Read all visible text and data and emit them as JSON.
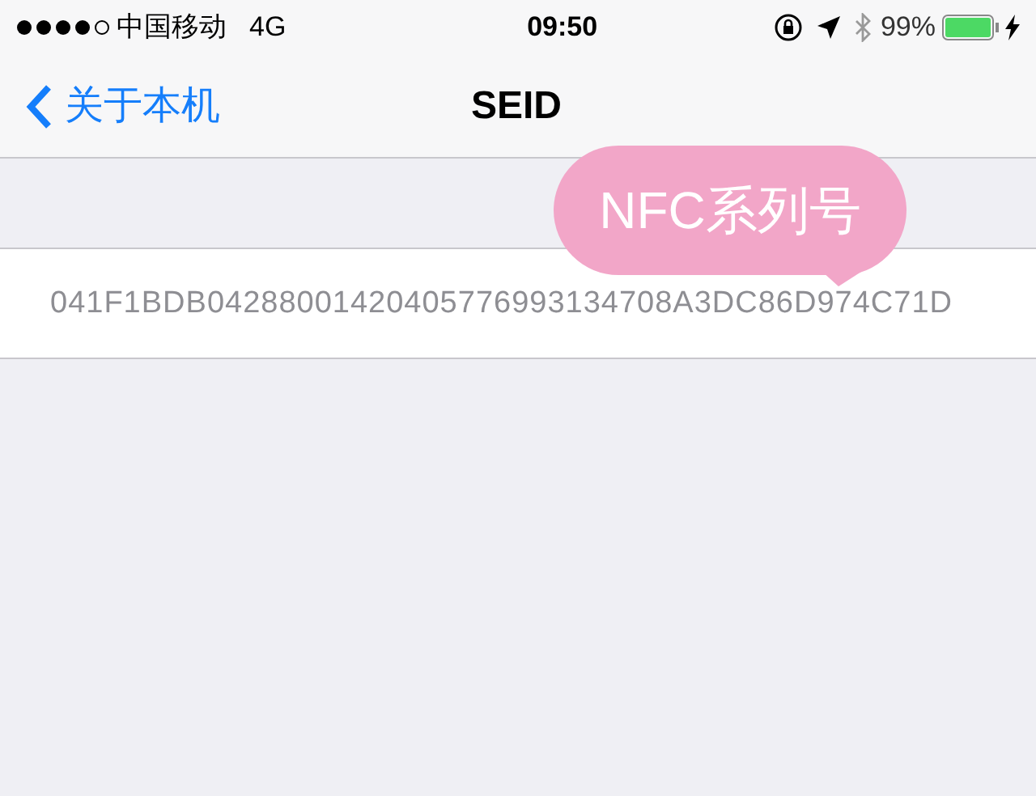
{
  "status_bar": {
    "carrier": "中国移动",
    "network": "4G",
    "time": "09:50",
    "battery": "99%"
  },
  "nav": {
    "back": "关于本机",
    "title": "SEID"
  },
  "value": "041F1BDB04288001420405776993134708A3DC86D974C71D",
  "callout": "NFC系列号"
}
